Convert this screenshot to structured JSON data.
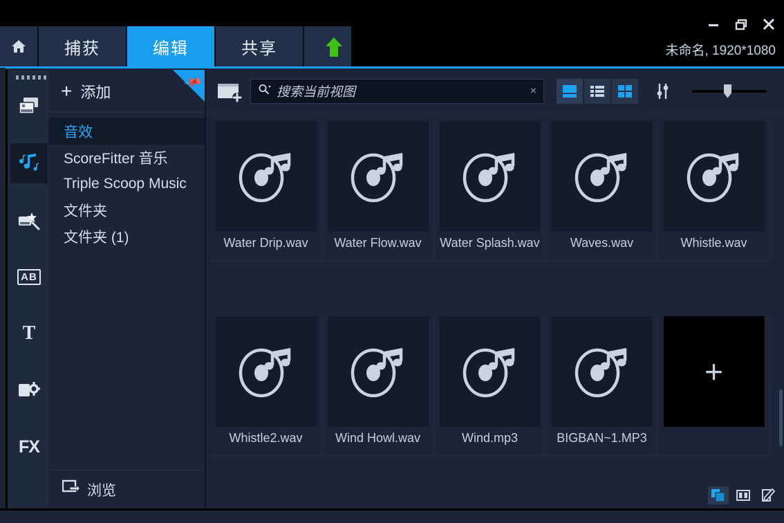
{
  "window": {
    "title": "未命名, 1920*1080",
    "controls": [
      {
        "name": "minimize",
        "glyph": "–"
      },
      {
        "name": "maximize",
        "glyph": "❐"
      },
      {
        "name": "close",
        "glyph": "✕"
      }
    ],
    "accent_color": "#1a9ef2",
    "background_color": "#1b2537"
  },
  "tabs": [
    {
      "id": "home",
      "label": "",
      "icon": "home-icon",
      "active": false
    },
    {
      "id": "capture",
      "label": "捕获",
      "active": false
    },
    {
      "id": "edit",
      "label": "编辑",
      "active": true
    },
    {
      "id": "share",
      "label": "共享",
      "active": false
    }
  ],
  "upload_arrow": {
    "name": "upload-arrow-icon",
    "color": "#3fc214"
  },
  "rail": {
    "items": [
      {
        "id": "media",
        "icon": "media-library-icon",
        "label": "",
        "active": false
      },
      {
        "id": "audio",
        "icon": "music-note-icon",
        "label": "",
        "active": true
      },
      {
        "id": "effects",
        "icon": "magic-wand-icon",
        "label": "",
        "active": false
      },
      {
        "id": "transitions",
        "icon": "ab-transition-icon",
        "label": "AB",
        "active": false
      },
      {
        "id": "titles",
        "icon": "title-text-icon",
        "label": "T",
        "active": false
      },
      {
        "id": "overlays",
        "icon": "overlay-settings-icon",
        "label": "",
        "active": false
      },
      {
        "id": "fx",
        "icon": "fx-icon",
        "label": "FX",
        "active": false
      }
    ]
  },
  "library": {
    "header": {
      "add_label": "添加",
      "plus": "+",
      "pin_icon": "pin-icon"
    },
    "items": [
      {
        "label": "音效",
        "selected": true
      },
      {
        "label": "ScoreFitter 音乐",
        "selected": false
      },
      {
        "label": "Triple Scoop Music",
        "selected": false
      },
      {
        "label": "文件夹",
        "selected": false
      },
      {
        "label": "文件夹 (1)",
        "selected": false
      }
    ],
    "footer": {
      "label": "浏览",
      "icon": "browse-export-icon"
    }
  },
  "toolbar": {
    "folder_add_icon": "folder-add-icon",
    "search": {
      "placeholder": "搜索当前视图",
      "value": "",
      "icon": "search-icon",
      "clear_glyph": "×"
    },
    "views": [
      {
        "id": "large",
        "icon": "large-thumbnail-view-icon",
        "active": true
      },
      {
        "id": "list",
        "icon": "list-view-icon",
        "active": false
      },
      {
        "id": "grid",
        "icon": "grid-view-icon",
        "active": false
      }
    ],
    "sort": {
      "icon": "sort-sliders-icon"
    },
    "size_slider": {
      "icon": "thumbnail-size-slider",
      "value": 45
    }
  },
  "media_items": [
    {
      "name": "Water Drip.wav",
      "type": "audio"
    },
    {
      "name": "Water Flow.wav",
      "type": "audio"
    },
    {
      "name": "Water Splash.wav",
      "type": "audio"
    },
    {
      "name": "Waves.wav",
      "type": "audio"
    },
    {
      "name": "Whistle.wav",
      "type": "audio"
    },
    {
      "name": "Whistle2.wav",
      "type": "audio"
    },
    {
      "name": "Wind Howl.wav",
      "type": "audio"
    },
    {
      "name": "Wind.mp3",
      "type": "audio"
    },
    {
      "name": "BIGBAN~1.MP3",
      "type": "audio"
    },
    {
      "name": "",
      "type": "add",
      "glyph": "+"
    }
  ],
  "corner_icons": [
    {
      "id": "multi-layer",
      "icon": "multi-layer-view-icon",
      "active": true
    },
    {
      "id": "split-panel",
      "icon": "split-panel-icon",
      "active": false
    },
    {
      "id": "edit-mode",
      "icon": "edit-pencil-icon",
      "active": false
    }
  ]
}
